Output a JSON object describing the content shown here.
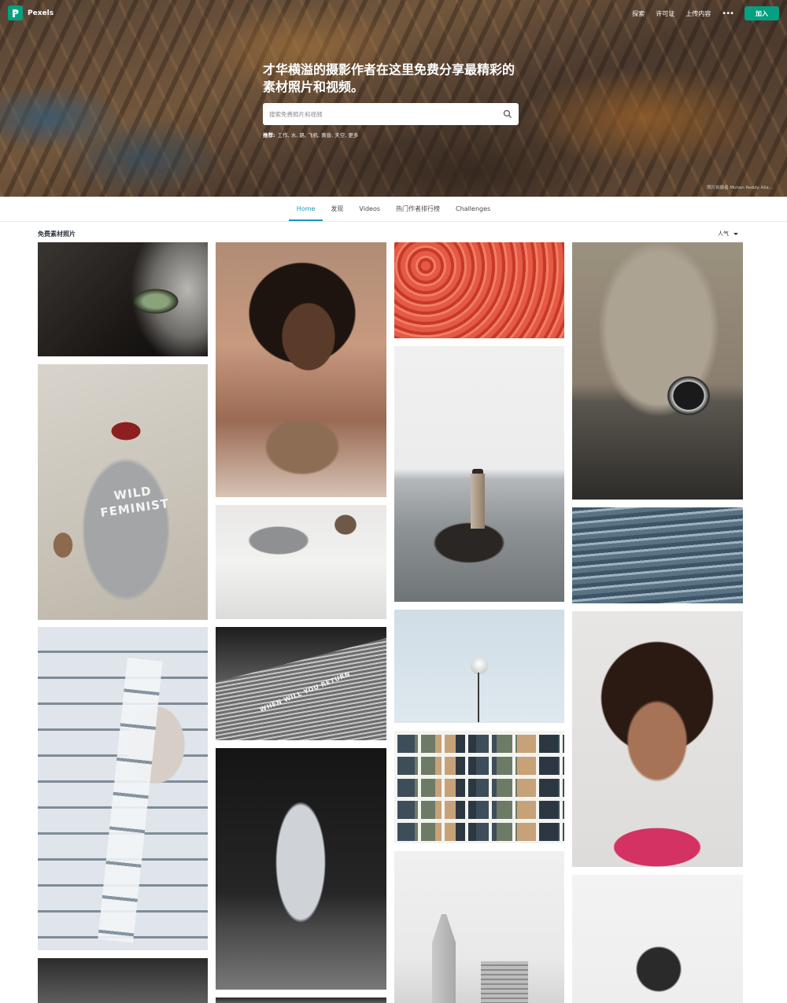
{
  "nav": {
    "brand": "Pexels",
    "links": [
      "探索",
      "许可证",
      "上传内容"
    ],
    "more": "•••",
    "join": "加入"
  },
  "hero": {
    "title": "才华横溢的摄影作者在这里免费分享最精彩的素材照片和视频。",
    "search_placeholder": "搜索免费照片和视频",
    "suggest_label": "推荐:",
    "suggestions": "工作, 水, 路, 飞机, 黄昏, 天空, 更多",
    "credit": "照片拍摄者 Mohan Reddy Alla..."
  },
  "tabs": [
    "Home",
    "发现",
    "Videos",
    "热门作者排行榜",
    "Challenges"
  ],
  "section": {
    "title": "免费素材照片",
    "sort": "人气"
  },
  "photos": {
    "coat_text_1": "WILD",
    "coat_text_2": "FEMINIST",
    "building_text": "WHEN WILL YOU RETURN"
  },
  "colors": {
    "brand": "#05a081",
    "active_tab": "#1a95b8"
  }
}
